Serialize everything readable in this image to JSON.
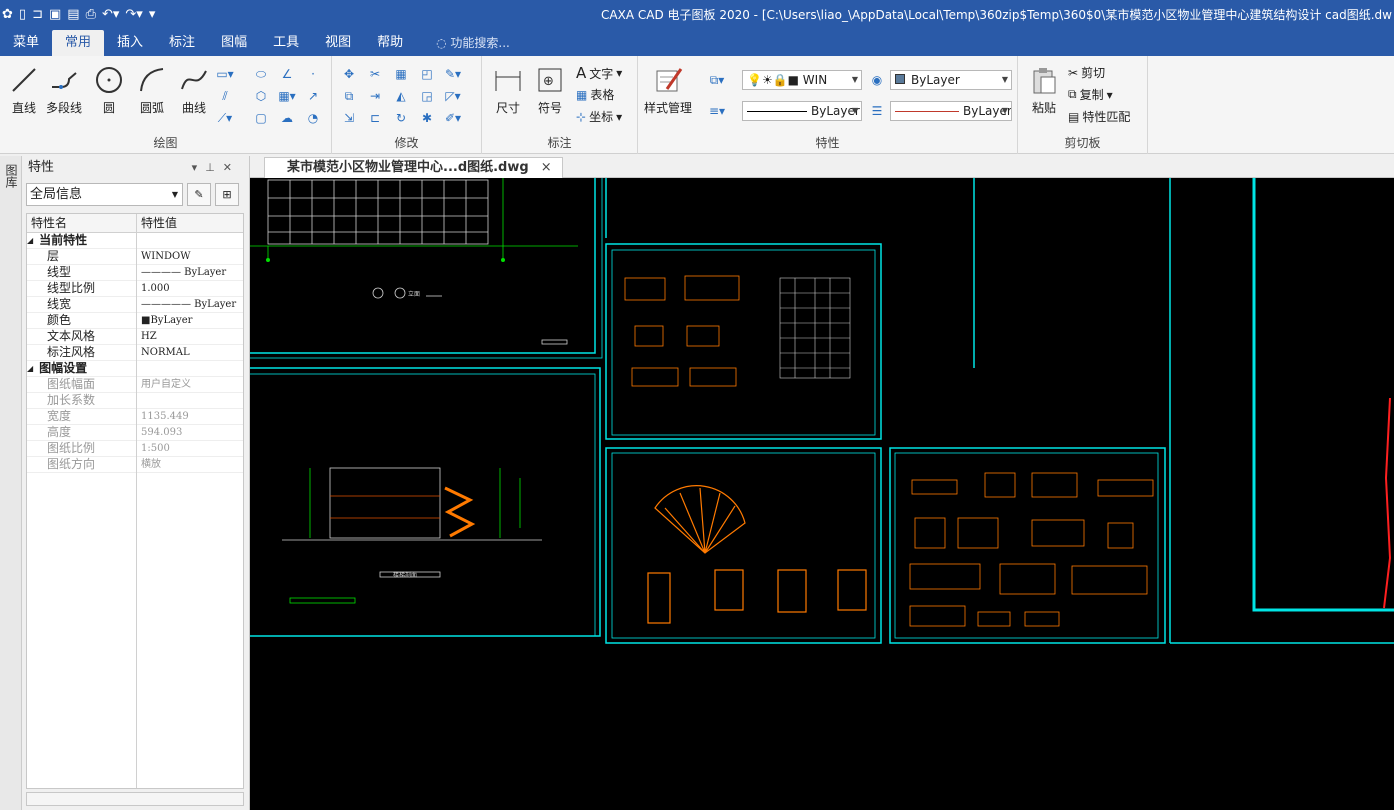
{
  "titlebar": {
    "title": "CAXA CAD 电子图板 2020 - [C:\\Users\\liao_\\AppData\\Local\\Temp\\360zip$Temp\\360$0\\某市模范小区物业管理中心建筑结构设计 cad图纸.dw"
  },
  "menu": {
    "items": [
      "菜单",
      "常用",
      "插入",
      "标注",
      "图幅",
      "工具",
      "视图",
      "帮助"
    ],
    "active": "常用",
    "search_placeholder": "功能搜索..."
  },
  "ribbon": {
    "draw": {
      "title": "绘图",
      "line": "直线",
      "polyline": "多段线",
      "circle": "圆",
      "arc": "圆弧",
      "curve": "曲线"
    },
    "modify": {
      "title": "修改"
    },
    "annotate": {
      "title": "标注",
      "dimension": "尺寸",
      "symbol": "符号",
      "text": "文字",
      "table": "表格",
      "coordinate": "坐标"
    },
    "properties": {
      "title": "特性",
      "style_manager": "样式管理",
      "layer_combo": "WIN",
      "color_combo": "ByLayer",
      "linetype_combo": "ByLayer",
      "lineweight_combo": "ByLayer"
    },
    "clipboard": {
      "title": "剪切板",
      "paste": "粘贴",
      "cut": "剪切",
      "copy": "复制",
      "match": "特性匹配"
    }
  },
  "panel": {
    "vertical_tab": "图库",
    "title": "特性",
    "scope": "全局信息",
    "col_name": "特性名",
    "col_value": "特性值",
    "rows": [
      {
        "name": "当前特性",
        "value": "",
        "section": true
      },
      {
        "name": "层",
        "value": "WINDOW"
      },
      {
        "name": "线型",
        "value": "———— ByLayer"
      },
      {
        "name": "线型比例",
        "value": "1.000"
      },
      {
        "name": "线宽",
        "value": "————— ByLayer"
      },
      {
        "name": "颜色",
        "value": "■ByLayer"
      },
      {
        "name": "文本风格",
        "value": "HZ"
      },
      {
        "name": "标注风格",
        "value": "NORMAL"
      },
      {
        "name": "图幅设置",
        "value": "",
        "section": true
      },
      {
        "name": "图纸幅面",
        "value": "用户自定义",
        "dim": true
      },
      {
        "name": "加长系数",
        "value": "",
        "dim": true
      },
      {
        "name": "宽度",
        "value": "1135.449",
        "dim": true
      },
      {
        "name": "高度",
        "value": "594.093",
        "dim": true
      },
      {
        "name": "图纸比例",
        "value": "1:500",
        "dim": true
      },
      {
        "name": "图纸方向",
        "value": "横放",
        "dim": true
      }
    ]
  },
  "document": {
    "tab_label": "某市模范小区物业管理中心...d图纸.dwg",
    "close": "×"
  },
  "drawing": {
    "elevation_label": "立面",
    "section_label": "楼梯剖面"
  }
}
